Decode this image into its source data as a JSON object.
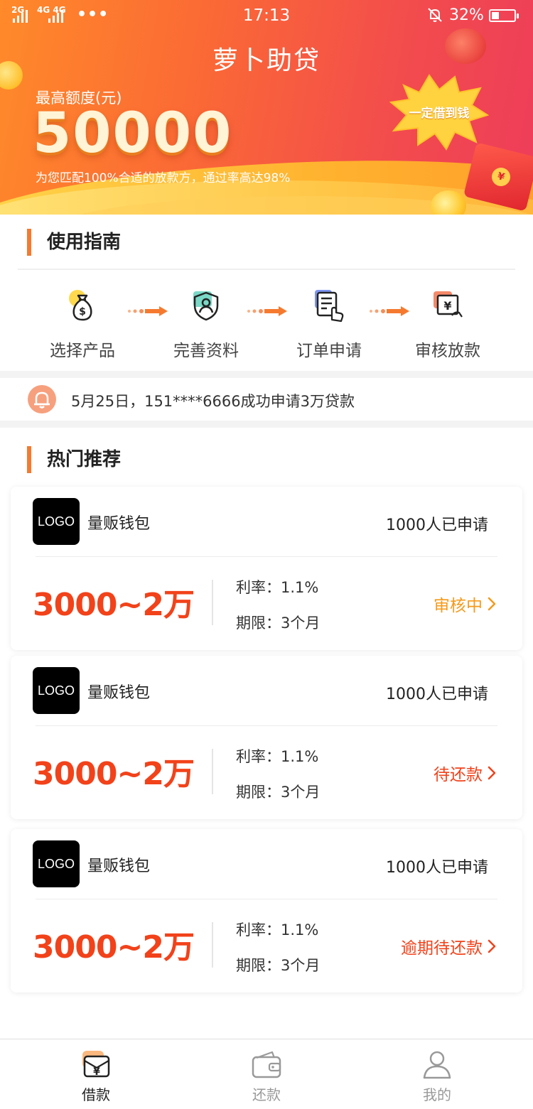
{
  "status_bar": {
    "signal_1": "2G",
    "signal_2": "4G 4G",
    "time": "17:13",
    "battery": "32%",
    "battery_level": 0.32
  },
  "banner": {
    "title": "萝卜助贷",
    "max_label": "最高额度(元)",
    "max_amount": "50000",
    "subtitle": "为您匹配100%合适的放款方，通过率高达98%",
    "burst_text": "一定借到钱",
    "envelope_symbol": "¥"
  },
  "guide": {
    "title": "使用指南",
    "steps": [
      {
        "label": "选择产品",
        "icon": "money-bag-icon"
      },
      {
        "label": "完善资料",
        "icon": "shield-user-icon"
      },
      {
        "label": "订单申请",
        "icon": "document-hand-icon"
      },
      {
        "label": "审核放款",
        "icon": "yen-cash-icon"
      }
    ]
  },
  "notice": {
    "icon": "bell-icon",
    "text": "5月25日，151****6666成功申请3万贷款"
  },
  "hot": {
    "title": "热门推荐",
    "cards": [
      {
        "logo": "LOGO",
        "name": "量贩钱包",
        "applied": "1000人已申请",
        "amount": "3000~2万",
        "rate": "利率：1.1%",
        "term": "期限：3个月",
        "status": "审核中",
        "status_color": "#f59a1b"
      },
      {
        "logo": "LOGO",
        "name": "量贩钱包",
        "applied": "1000人已申请",
        "amount": "3000~2万",
        "rate": "利率：1.1%",
        "term": "期限：3个月",
        "status": "待还款",
        "status_color": "#f2421a"
      },
      {
        "logo": "LOGO",
        "name": "量贩钱包",
        "applied": "1000人已申请",
        "amount": "3000~2万",
        "rate": "利率：1.1%",
        "term": "期限：3个月",
        "status": "逾期待还款",
        "status_color": "#f2421a"
      }
    ]
  },
  "tabbar": {
    "items": [
      {
        "label": "借款",
        "icon": "loan-icon",
        "active": true
      },
      {
        "label": "还款",
        "icon": "wallet-icon",
        "active": false
      },
      {
        "label": "我的",
        "icon": "user-icon",
        "active": false
      }
    ],
    "active_color": "#222222",
    "inactive_color": "#999999"
  },
  "colors": {
    "accent": "#f57a2f",
    "amount_red": "#f2421a",
    "banner_start": "#ff8a2a",
    "banner_end": "#ee3d5a"
  }
}
